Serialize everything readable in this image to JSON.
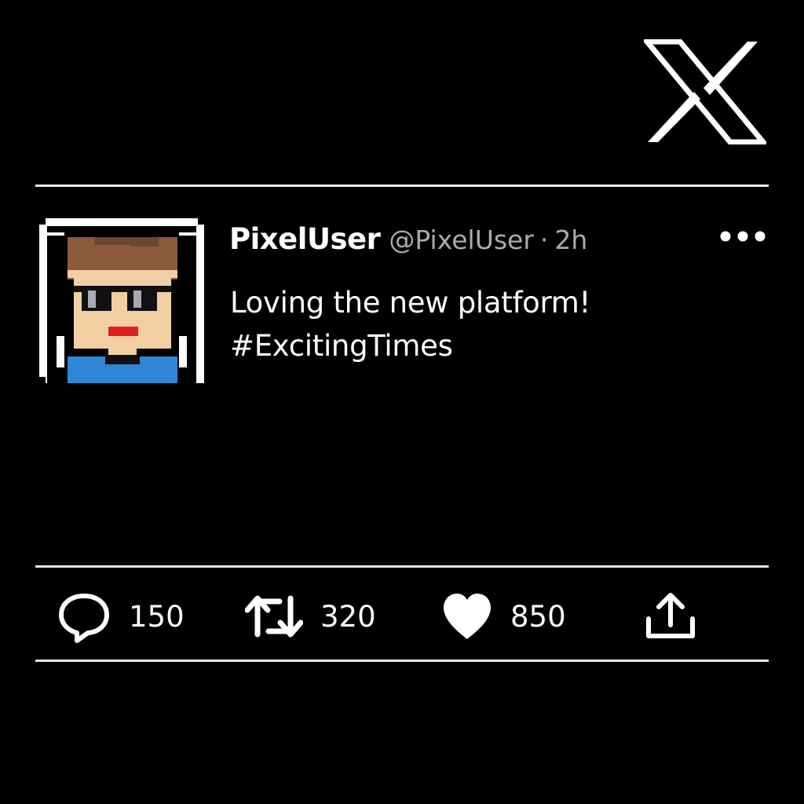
{
  "post": {
    "display_name": "PixelUser",
    "handle": "@PixelUser",
    "separator": "·",
    "time": "2h",
    "text_lines": [
      "Loving the new platform!",
      "#ExcitingTimes"
    ],
    "avatar_icon": "pixel-art-avatar"
  },
  "actions": {
    "reply_count": "150",
    "retweet_count": "320",
    "like_count": "850"
  },
  "icons": {
    "logo": "x-logo-icon",
    "more": "more-dots-icon",
    "reply": "comment-bubble-icon",
    "retweet": "retweet-arrows-icon",
    "like": "heart-icon",
    "share": "share-upload-icon"
  },
  "colors": {
    "background": "#000000",
    "text": "#ffffff",
    "secondary_text": "#a8acb3",
    "divider": "#e8e8e8"
  }
}
